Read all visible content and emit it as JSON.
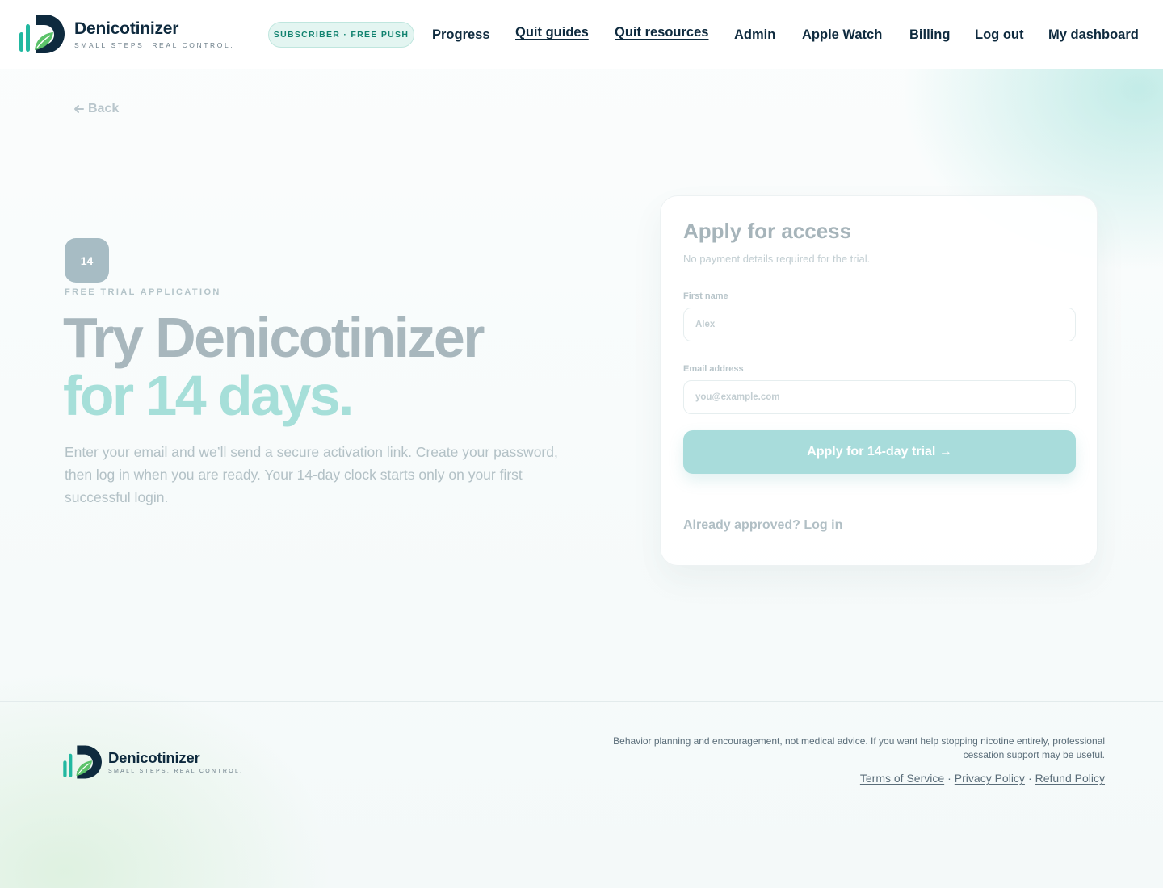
{
  "brand": {
    "name": "Denicotinizer",
    "tagline": "SMALL STEPS. REAL CONTROL.",
    "colors": {
      "navy": "#0e2a3e",
      "teal": "#22b8a0",
      "green": "#5cc36a"
    }
  },
  "header": {
    "plan_badge": "SUBSCRIBER · FREE PUSH",
    "nav": [
      {
        "label": "Progress",
        "underlined": false
      },
      {
        "label": "Quit guides",
        "underlined": true
      },
      {
        "label": "Quit resources",
        "underlined": true
      },
      {
        "label": "Admin",
        "underlined": false
      },
      {
        "label": "Apple Watch",
        "underlined": false
      },
      {
        "label": "Billing",
        "underlined": false
      },
      {
        "label": "Log out",
        "underlined": false
      },
      {
        "label": "My dashboard",
        "underlined": false
      }
    ]
  },
  "main": {
    "back_label": "Back",
    "back_icon": "arrow-left-icon",
    "badge": "14",
    "eyebrow": "FREE TRIAL APPLICATION",
    "heading_line1": "Try Denicotinizer",
    "heading_line2": "for 14 days.",
    "lead": "Enter your email and we’ll send a secure activation link. Create your password, then log in when you are ready. Your 14-day clock starts only on your first successful login."
  },
  "form": {
    "title": "Apply for access",
    "subtitle": "No payment details required for the trial.",
    "first_name_label": "First name",
    "first_name_placeholder": "Alex",
    "email_label": "Email address",
    "email_placeholder": "you@example.com",
    "submit_label": "Apply for 14-day trial →",
    "login_link": "Already approved? Log in"
  },
  "footer": {
    "brand_name": "Denicotinizer",
    "brand_tagline": "SMALL STEPS. REAL CONTROL.",
    "disclaimer": "Behavior planning and encouragement, not medical advice. If you want help stopping nicotine entirely, professional cessation support may be useful.",
    "links": [
      "Terms of Service",
      "Privacy Policy",
      "Refund Policy"
    ]
  }
}
